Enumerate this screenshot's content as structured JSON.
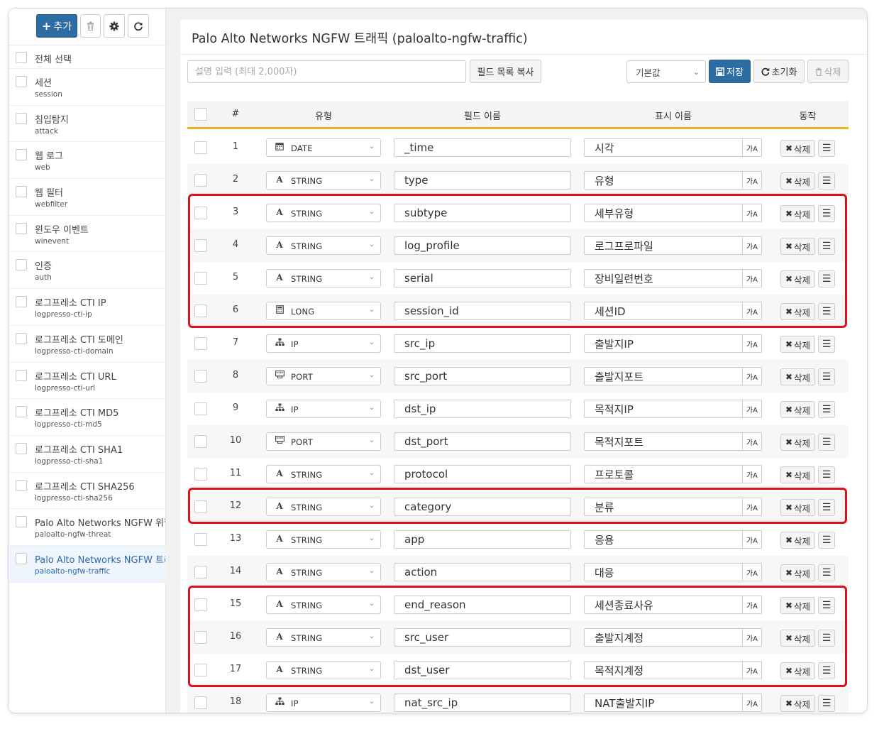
{
  "toolbar": {
    "add_label": "추가",
    "add_icon": "plus-icon",
    "trash_icon": "trash-icon",
    "gear_icon": "gear-icon",
    "refresh_icon": "refresh-icon"
  },
  "sidebar": {
    "select_all": "전체 선택",
    "items": [
      {
        "label": "세션",
        "sub": "session"
      },
      {
        "label": "침입탐지",
        "sub": "attack"
      },
      {
        "label": "웹 로그",
        "sub": "web"
      },
      {
        "label": "웹 필터",
        "sub": "webfilter"
      },
      {
        "label": "윈도우 이벤트",
        "sub": "winevent"
      },
      {
        "label": "인증",
        "sub": "auth"
      },
      {
        "label": "로그프레소 CTI IP",
        "sub": "logpresso-cti-ip"
      },
      {
        "label": "로그프레소 CTI 도메인",
        "sub": "logpresso-cti-domain"
      },
      {
        "label": "로그프레소 CTI URL",
        "sub": "logpresso-cti-url"
      },
      {
        "label": "로그프레소 CTI MD5",
        "sub": "logpresso-cti-md5"
      },
      {
        "label": "로그프레소 CTI SHA1",
        "sub": "logpresso-cti-sha1"
      },
      {
        "label": "로그프레소 CTI SHA256",
        "sub": "logpresso-cti-sha256"
      },
      {
        "label": "Palo Alto Networks NGFW 위협",
        "sub": "paloalto-ngfw-threat"
      },
      {
        "label": "Palo Alto Networks NGFW 트래픽",
        "sub": "paloalto-ngfw-traffic",
        "selected": true
      }
    ]
  },
  "panel": {
    "title": "Palo Alto Networks NGFW 트래픽 (paloalto-ngfw-traffic)",
    "desc_placeholder": "설명 입력 (최대 2,000자)",
    "copy_button": "필드 목록 복사",
    "default_select": "기본값",
    "save_button": "저장",
    "reset_button": "초기화",
    "delete_button": "삭제"
  },
  "table": {
    "headers": {
      "num": "#",
      "type": "유형",
      "field": "필드 이름",
      "display": "표시 이름",
      "action": "동작"
    },
    "row_delete": "삭제",
    "translate_glyph": "가A",
    "rows": [
      {
        "num": "1",
        "type": "DATE",
        "icon": "calendar-icon",
        "field": "_time",
        "display": "시각"
      },
      {
        "num": "2",
        "type": "STRING",
        "icon": "string-icon",
        "field": "type",
        "display": "유형"
      },
      {
        "num": "3",
        "type": "STRING",
        "icon": "string-icon",
        "field": "subtype",
        "display": "세부유형"
      },
      {
        "num": "4",
        "type": "STRING",
        "icon": "string-icon",
        "field": "log_profile",
        "display": "로그프로파일"
      },
      {
        "num": "5",
        "type": "STRING",
        "icon": "string-icon",
        "field": "serial",
        "display": "장비일련번호"
      },
      {
        "num": "6",
        "type": "LONG",
        "icon": "calculator-icon",
        "field": "session_id",
        "display": "세션ID"
      },
      {
        "num": "7",
        "type": "IP",
        "icon": "network-icon",
        "field": "src_ip",
        "display": "출발지IP"
      },
      {
        "num": "8",
        "type": "PORT",
        "icon": "port-icon",
        "field": "src_port",
        "display": "출발지포트"
      },
      {
        "num": "9",
        "type": "IP",
        "icon": "network-icon",
        "field": "dst_ip",
        "display": "목적지IP"
      },
      {
        "num": "10",
        "type": "PORT",
        "icon": "port-icon",
        "field": "dst_port",
        "display": "목적지포트"
      },
      {
        "num": "11",
        "type": "STRING",
        "icon": "string-icon",
        "field": "protocol",
        "display": "프로토콜"
      },
      {
        "num": "12",
        "type": "STRING",
        "icon": "string-icon",
        "field": "category",
        "display": "분류"
      },
      {
        "num": "13",
        "type": "STRING",
        "icon": "string-icon",
        "field": "app",
        "display": "응용"
      },
      {
        "num": "14",
        "type": "STRING",
        "icon": "string-icon",
        "field": "action",
        "display": "대응"
      },
      {
        "num": "15",
        "type": "STRING",
        "icon": "string-icon",
        "field": "end_reason",
        "display": "세션종료사유"
      },
      {
        "num": "16",
        "type": "STRING",
        "icon": "string-icon",
        "field": "src_user",
        "display": "출발지계정"
      },
      {
        "num": "17",
        "type": "STRING",
        "icon": "string-icon",
        "field": "dst_user",
        "display": "목적지계정"
      },
      {
        "num": "18",
        "type": "IP",
        "icon": "network-icon",
        "field": "nat_src_ip",
        "display": "NAT출발지IP"
      }
    ]
  },
  "highlights": [
    {
      "from_row": 3,
      "to_row": 6
    },
    {
      "from_row": 12,
      "to_row": 12
    },
    {
      "from_row": 15,
      "to_row": 17
    }
  ],
  "colors": {
    "primary": "#2e6da4",
    "highlight": "#e0101a",
    "header_border": "#f0b429"
  }
}
